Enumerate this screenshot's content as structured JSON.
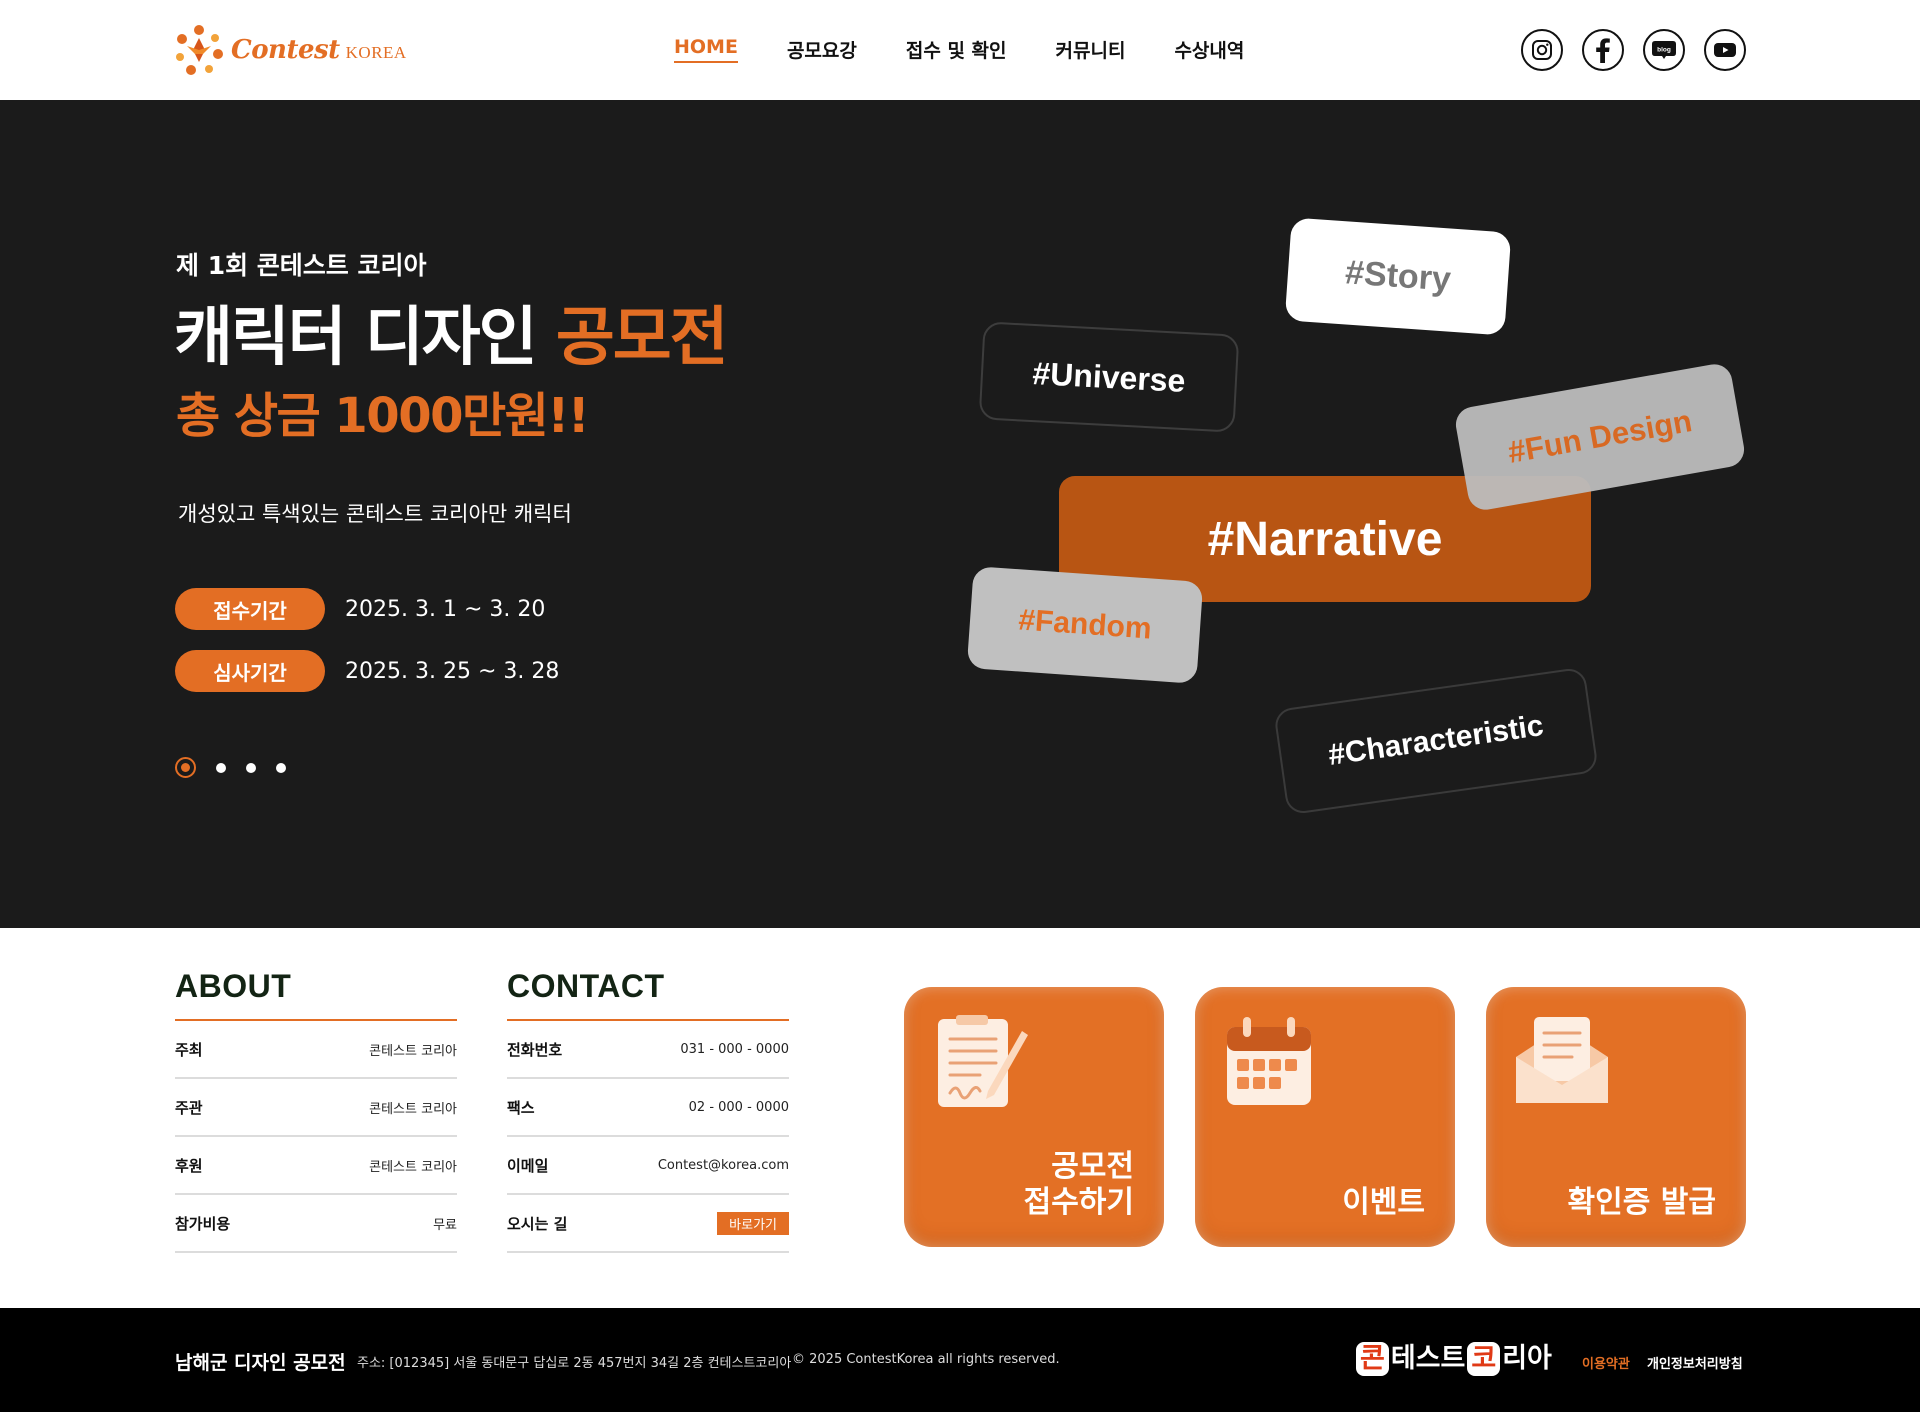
{
  "header": {
    "logo_script": "Contest",
    "logo_korea": "KOREA",
    "nav": [
      "HOME",
      "공모요강",
      "접수 및 확인",
      "커뮤니티",
      "수상내역"
    ],
    "social_icons": [
      "instagram-icon",
      "facebook-icon",
      "blog-icon",
      "youtube-icon"
    ],
    "blog_label": "blog"
  },
  "hero": {
    "edition": "제 1회 콘테스트 코리아",
    "title_main": "캐릭터 디자인 ",
    "title_accent": "공모전",
    "prize": "총 상금 1000만원!!",
    "description": "개성있고 특색있는 콘테스트 코리아만  캐릭터",
    "periods": [
      {
        "label": "접수기간",
        "date": "2025. 3. 1 ~ 3. 20"
      },
      {
        "label": "심사기간",
        "date": "2025. 3. 25 ~ 3. 28"
      }
    ],
    "slides": 4,
    "active_slide": 1,
    "tags": [
      "#Story",
      "#Universe",
      "#Fun Design",
      "#Narrative",
      "#Fandom",
      "#Characteristic"
    ]
  },
  "about": {
    "heading": "ABOUT",
    "rows": [
      {
        "key": "주최",
        "value": "콘테스트 코리아"
      },
      {
        "key": "주관",
        "value": "콘테스트 코리아"
      },
      {
        "key": "후원",
        "value": "콘테스트 코리아"
      },
      {
        "key": "참가비용",
        "value": "무료"
      }
    ]
  },
  "contact": {
    "heading": "CONTACT",
    "rows": [
      {
        "key": "전화번호",
        "value": "031 - 000 - 0000"
      },
      {
        "key": "팩스",
        "value": "02 - 000 - 0000"
      },
      {
        "key": "이메일",
        "value": "Contest@korea.com"
      },
      {
        "key": "오시는 길",
        "value": "바로가기"
      }
    ]
  },
  "cards": [
    {
      "label": "공모전\n접수하기",
      "icon": "clipboard-pen-icon"
    },
    {
      "label": "이벤트",
      "icon": "calendar-icon"
    },
    {
      "label": "확인증 발급",
      "icon": "envelope-letter-icon"
    }
  ],
  "footer": {
    "title": "남해군 디자인 공모전",
    "address": "주소: [012345] 서울 동대문구 답십로 2동 457번지 34길 2층 컨테스트코리아",
    "copyright": "© 2025 ContestKorea all rights reserved.",
    "brand_box1": "콘",
    "brand_text1": "테스트",
    "brand_box2": "코",
    "brand_text2": "리아",
    "terms": "이용약관",
    "privacy": "개인정보처리방침"
  },
  "colors": {
    "accent": "#e36e24",
    "hero_bg": "#1b1b1b",
    "footer_bg": "#000000"
  }
}
